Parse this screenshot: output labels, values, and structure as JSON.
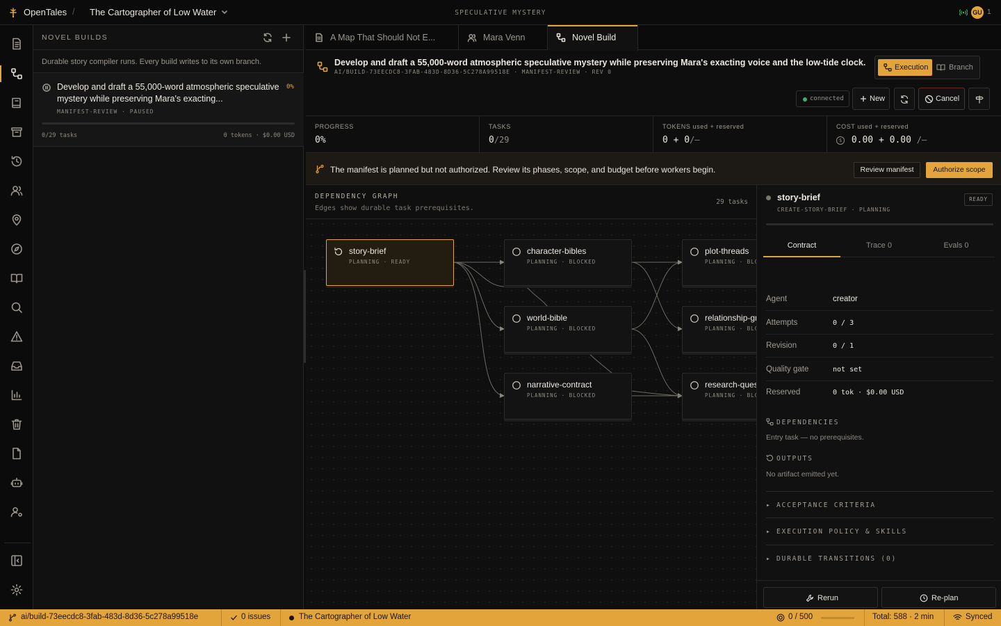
{
  "app": {
    "name": "OpenTales",
    "project": "The Cartographer of Low Water",
    "genre": "SPECULATIVE MYSTERY",
    "user_initials": "GU",
    "user_count": "1"
  },
  "rail": {
    "icons": [
      "document-icon",
      "builds-icon",
      "book-icon",
      "archive-icon",
      "history-icon",
      "people-icon",
      "location-icon",
      "compass-icon",
      "open-book-icon",
      "search-icon",
      "warning-icon",
      "inbox-icon",
      "chart-icon",
      "trash-icon",
      "file-icon",
      "bot-icon",
      "user-settings-icon",
      "collapse-sidebar-icon",
      "settings-icon"
    ]
  },
  "builds": {
    "title": "NOVEL BUILDS",
    "description": "Durable story compiler runs. Every build writes to its own branch.",
    "item": {
      "title": "Develop and draft a 55,000-word atmospheric speculative mystery while preserving Mara's exacting...",
      "percent": "0%",
      "meta": "MANIFEST-REVIEW · PAUSED",
      "progress": 0,
      "tasks": "0/29 tasks",
      "usage": "0 tokens · $0.00 USD"
    }
  },
  "tabs": [
    {
      "label": "A Map That Should Not E...",
      "icon": "document-icon"
    },
    {
      "label": "Mara Venn",
      "icon": "person-icon"
    },
    {
      "label": "Novel Build",
      "icon": "builds-icon"
    }
  ],
  "header": {
    "title": "Develop and draft a 55,000-word atmospheric speculative mystery while preserving Mara's exacting voice and the low-tide clock.",
    "meta": "AI/BUILD-73EECDC8-3FAB-483D-8D36-5C278A99518E · MANIFEST-REVIEW · REV 0",
    "mode_execution": "Execution",
    "mode_branch": "Branch",
    "connection": "connected",
    "new_label": "New",
    "cancel_label": "Cancel"
  },
  "metrics": {
    "progress_label": "PROGRESS",
    "progress_value": "0",
    "progress_unit": "%",
    "tasks_label": "TASKS",
    "tasks_done": "0",
    "tasks_total": "/29",
    "tokens_label": "TOKENS used + reserved",
    "tokens_value": "0 + 0",
    "tokens_limit": "/—",
    "cost_label": "COST used + reserved",
    "cost_symbol": "$",
    "cost_value": "0.00 + 0.00",
    "cost_limit": "/—"
  },
  "banner": {
    "text": "The manifest is planned but not authorized. Review its phases, scope, and budget before workers begin.",
    "review_label": "Review manifest",
    "authorize_label": "Authorize scope"
  },
  "graph": {
    "title": "DEPENDENCY GRAPH",
    "subtitle": "Edges show durable task prerequisites.",
    "count": "29 tasks",
    "nodes": [
      {
        "name": "story-brief",
        "meta": "PLANNING · READY"
      },
      {
        "name": "character-bibles",
        "meta": "PLANNING · BLOCKED"
      },
      {
        "name": "world-bible",
        "meta": "PLANNING · BLOCKED"
      },
      {
        "name": "narrative-contract",
        "meta": "PLANNING · BLOCKED"
      },
      {
        "name": "plot-threads",
        "meta": "PLANNING · BLOCKED"
      },
      {
        "name": "relationship-graph",
        "meta": "PLANNING · BLOCKED"
      },
      {
        "name": "research-questions",
        "meta": "PLANNING · BLOCKED"
      }
    ]
  },
  "inspector": {
    "name": "story-brief",
    "meta": "CREATE-STORY-BRIEF · PLANNING",
    "status": "READY",
    "tabs": [
      "Contract",
      "Trace 0",
      "Evals 0"
    ],
    "fields": [
      {
        "key": "Agent",
        "value": "creator"
      },
      {
        "key": "Attempts",
        "value": "0 / 3"
      },
      {
        "key": "Revision",
        "value": "0 / 1"
      },
      {
        "key": "Quality gate",
        "value": "not set"
      },
      {
        "key": "Reserved",
        "value": "0 tok · $0.00 USD"
      }
    ],
    "dependencies_title": "DEPENDENCIES",
    "dependencies_text": "Entry task — no prerequisites.",
    "outputs_title": "OUTPUTS",
    "outputs_text": "No artifact emitted yet.",
    "collapsibles": [
      "▸ ACCEPTANCE CRITERIA",
      "▸ EXECUTION POLICY & SKILLS",
      "▸ DURABLE TRANSITIONS (0)"
    ],
    "rerun_label": "Rerun",
    "replan_label": "Re-plan"
  },
  "statusbar": {
    "branch": "ai/build-73eecdc8-3fab-483d-8d36-5c278a99518e",
    "issues": "0 issues",
    "project": "The Cartographer of Low Water",
    "budget": "0 / 500",
    "budget_fraction": 0,
    "total": "Total: 588 · 2 min",
    "sync": "Synced"
  },
  "colors": {
    "accent": "#e3a53b",
    "background": "#0e0e0e",
    "panel": "#111111",
    "border": "#262626"
  }
}
